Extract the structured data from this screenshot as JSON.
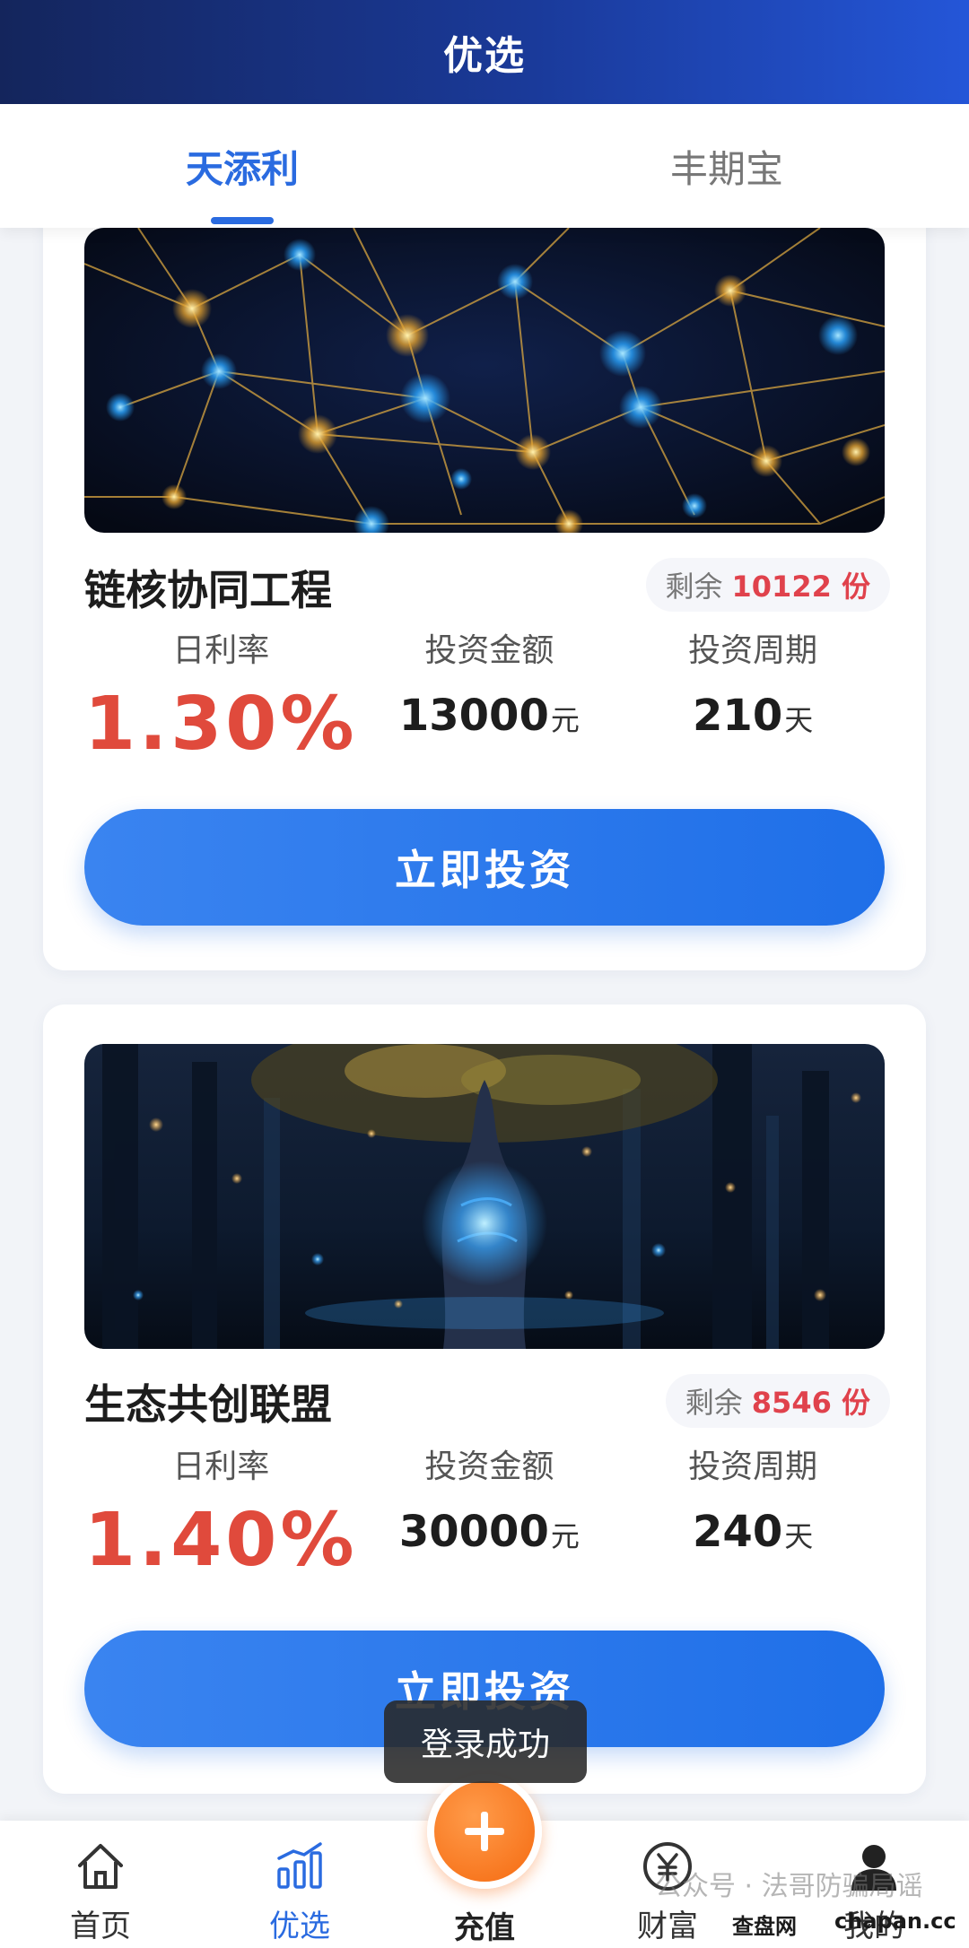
{
  "header": {
    "title": "优选"
  },
  "tabs": [
    {
      "label": "天添利",
      "active": true
    },
    {
      "label": "丰期宝",
      "active": false
    }
  ],
  "products": [
    {
      "name": "链核协同工程",
      "remain_label": "剩余",
      "remain_value": "10122 份",
      "rate_label": "日利率",
      "rate": "1.30%",
      "amount_label": "投资金额",
      "amount": "13000",
      "amount_unit": "元",
      "period_label": "投资周期",
      "period": "210",
      "period_unit": "天",
      "button": "立即投资"
    },
    {
      "name": "生态共创联盟",
      "remain_label": "剩余",
      "remain_value": "8546 份",
      "rate_label": "日利率",
      "rate": "1.40%",
      "amount_label": "投资金额",
      "amount": "30000",
      "amount_unit": "元",
      "period_label": "投资周期",
      "period": "240",
      "period_unit": "天",
      "button": "立即投资"
    }
  ],
  "toast": "登录成功",
  "bottom_nav": [
    {
      "label": "首页",
      "icon": "home-icon",
      "active": false
    },
    {
      "label": "优选",
      "icon": "chart-bars-icon",
      "active": true
    },
    {
      "label": "充值",
      "icon": "plus-icon",
      "active": false
    },
    {
      "label": "财富",
      "icon": "yen-icon",
      "active": false
    },
    {
      "label": "我的",
      "icon": "user-icon",
      "active": false
    }
  ],
  "watermark": {
    "text": "公众号 · 法哥防骗局谣",
    "brand_cn": "查盘网",
    "brand_url": "chapan.cc"
  },
  "colors": {
    "accent": "#2a6be0",
    "rate_red": "#e04a3c",
    "recharge_orange": "#f56a10",
    "header_dark": "#14255c"
  }
}
